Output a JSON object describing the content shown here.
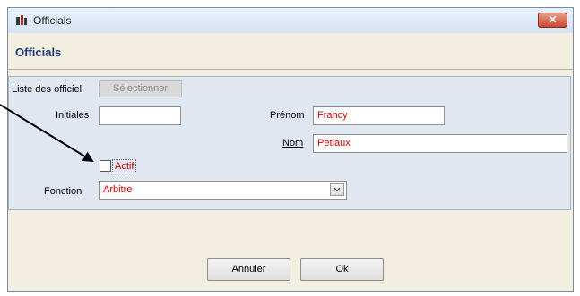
{
  "window": {
    "title": "Officials",
    "close_label": "✕"
  },
  "header": {
    "title": "Officials"
  },
  "form": {
    "liste_label": "Liste des officiel",
    "select_button": "Sélectionner",
    "initiales_label": "Initiales",
    "initiales_value": "",
    "prenom_label": "Prénom",
    "prenom_value": "Francy",
    "nom_label": "Nom",
    "nom_value": "Petiaux",
    "actif_label": "Actif",
    "actif_checked": false,
    "fonction_label": "Fonction",
    "fonction_value": "Arbitre"
  },
  "buttons": {
    "cancel": "Annuler",
    "ok": "Ok"
  },
  "colors": {
    "value_text": "#d40000",
    "header_title": "#1f3a73",
    "panel_bg": "#dfe8f0",
    "window_bg": "#f2eee0"
  },
  "annotation": {
    "icon": "arrow-icon"
  }
}
